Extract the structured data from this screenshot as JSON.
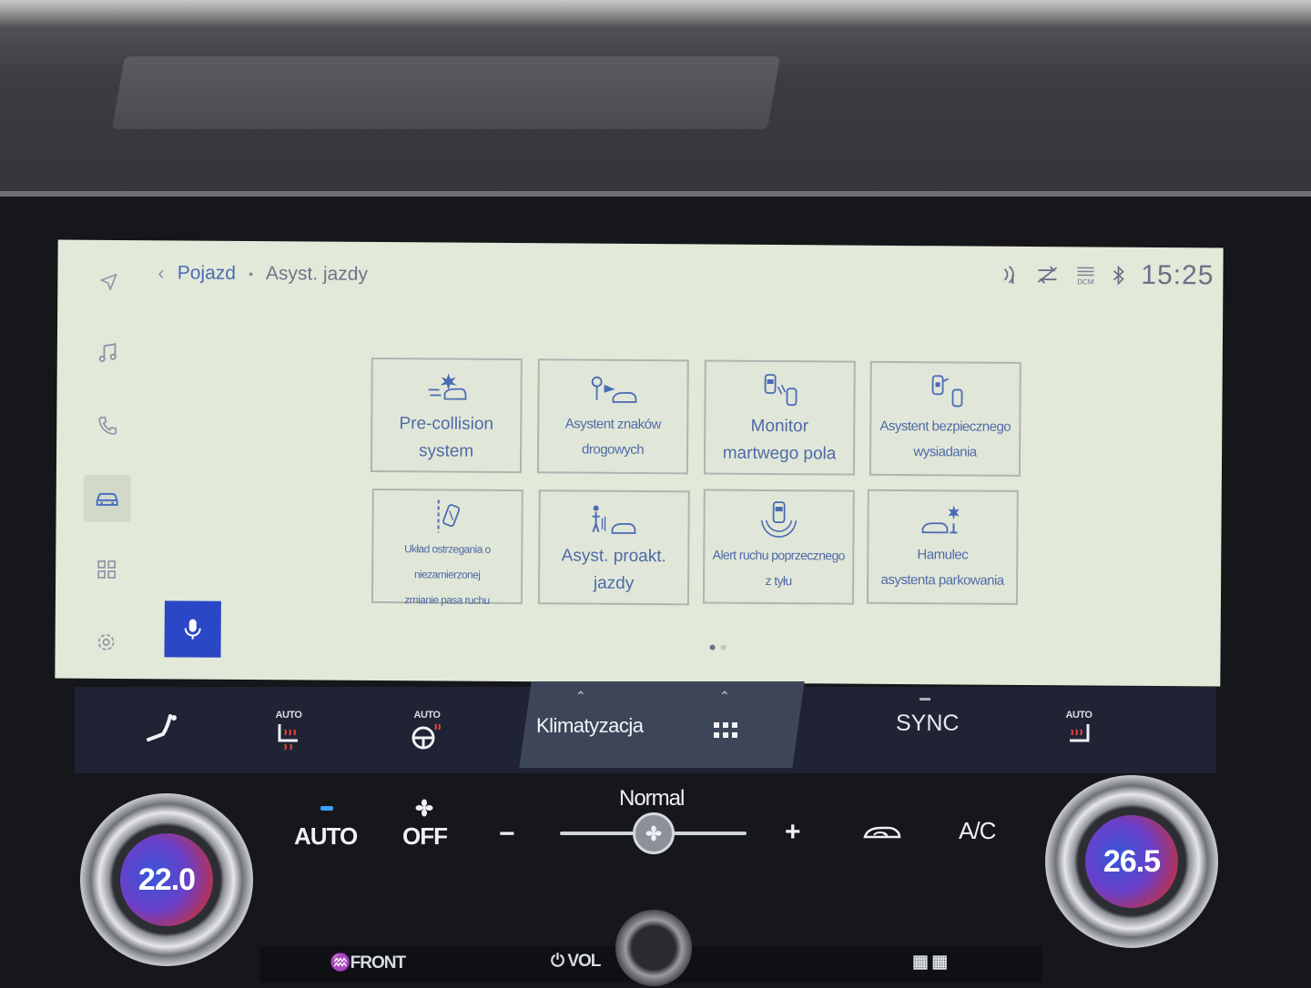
{
  "header": {
    "crumb_parent": "Pojazd",
    "crumb_separator": "•",
    "crumb_current": "Asyst. jazdy",
    "clock": "15:25",
    "dcm_label": "DCM"
  },
  "tiles": [
    {
      "label_line1": "Pre-collision",
      "label_line2": "system",
      "icon": "pre-collision-icon"
    },
    {
      "label_line1": "Asystent znaków",
      "label_line2": "drogowych",
      "icon": "road-sign-assist-icon"
    },
    {
      "label_line1": "Monitor",
      "label_line2": "martwego pola",
      "icon": "blind-spot-monitor-icon"
    },
    {
      "label_line1": "Asystent bezpiecznego",
      "label_line2": "wysiadania",
      "icon": "safe-exit-assist-icon"
    },
    {
      "label_line1": "Układ ostrzegania o niezamierzonej",
      "label_line2": "zmianie pasa ruchu",
      "icon": "lane-departure-icon"
    },
    {
      "label_line1": "Asyst. proakt.",
      "label_line2": "jazdy",
      "icon": "proactive-driving-assist-icon"
    },
    {
      "label_line1": "Alert ruchu poprzecznego",
      "label_line2": "z tyłu",
      "icon": "rear-cross-traffic-icon"
    },
    {
      "label_line1": "Hamulec",
      "label_line2": "asystenta parkowania",
      "icon": "parking-brake-assist-icon"
    }
  ],
  "pagination": {
    "current": 1,
    "total": 2
  },
  "climate_bar": {
    "seat_auto": "AUTO",
    "wheel_auto": "AUTO",
    "tab_label": "Klimatyzacja",
    "sync_label": "SYNC",
    "right_seat_auto": "AUTO"
  },
  "controls": {
    "auto_label": "AUTO",
    "off_label": "OFF",
    "fan_mode": "Normal",
    "minus": "−",
    "plus": "+",
    "ac_label": "A/C",
    "temp_left": "22.0",
    "temp_right": "26.5",
    "front_label": "FRONT",
    "vol_label": "VOL",
    "fan_level": 0.5
  },
  "colors": {
    "screen_bg": "#e3e9d9",
    "accent_blue": "#4b6bb5",
    "voice_button": "#2a47c6",
    "climate_bar": "#1f2333"
  }
}
